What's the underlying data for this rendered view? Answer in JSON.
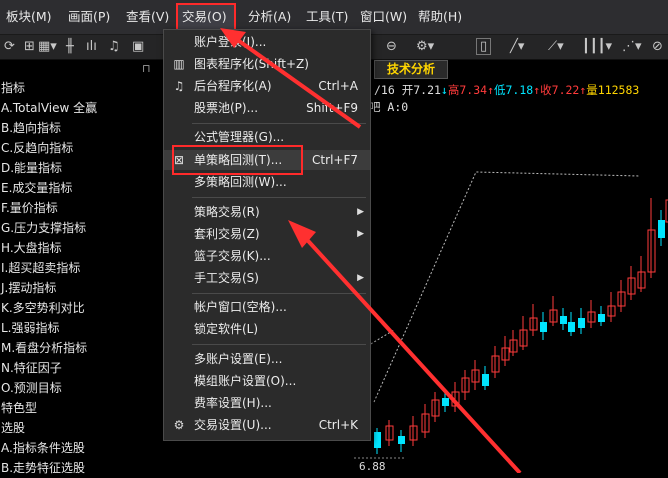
{
  "menubar": {
    "items": [
      {
        "label": "板块(M)"
      },
      {
        "label": "画面(P)"
      },
      {
        "label": "查看(V)"
      },
      {
        "label": "交易(O)"
      },
      {
        "label": "分析(A)"
      },
      {
        "label": "工具(T)"
      },
      {
        "label": "窗口(W)"
      },
      {
        "label": "帮助(H)"
      }
    ]
  },
  "left_panel": {
    "pin": "⊓",
    "items": [
      {
        "label": "指标"
      },
      {
        "label": "A.TotalView 全赢"
      },
      {
        "label": "B.趋向指标"
      },
      {
        "label": "C.反趋向指标"
      },
      {
        "label": "D.能量指标"
      },
      {
        "label": "E.成交量指标"
      },
      {
        "label": "F.量价指标"
      },
      {
        "label": "G.压力支撑指标"
      },
      {
        "label": "H.大盘指标"
      },
      {
        "label": "I.超买超卖指标"
      },
      {
        "label": "J.摆动指标"
      },
      {
        "label": "K.多空势利对比"
      },
      {
        "label": "L.强弱指标"
      },
      {
        "label": "M.看盘分析指标"
      },
      {
        "label": "N.特征因子"
      },
      {
        "label": "O.预测目标"
      },
      {
        "label": "特色型"
      },
      {
        "label": "选股"
      },
      {
        "label": "A.指标条件选股"
      },
      {
        "label": "B.走势特征选股"
      }
    ]
  },
  "chart": {
    "tab_label": "技术分析",
    "info": {
      "date": "/16",
      "open": "开7.21",
      "open_arrow": "↓",
      "high": "高7.34",
      "high_arrow": "↑",
      "low": "低7.18",
      "low_arrow": "↑",
      "close": "收7.22",
      "close_arrow": "↑",
      "volume": "量112583"
    },
    "info2": "吧 A:0",
    "low_price_label": "6.88",
    "colors": {
      "up": "#ff3b3b",
      "down": "#00e5ff",
      "tab_text": "#ffd500"
    }
  },
  "dropdown": {
    "items": [
      {
        "label": "账户登录(I)...",
        "shortcut": "",
        "icon": "",
        "submenu": false
      },
      {
        "label": "图表程序化(Shift+Z)",
        "shortcut": "",
        "icon": "chart-program-icon",
        "submenu": false
      },
      {
        "label": "后台程序化(A)",
        "shortcut": "Ctrl+A",
        "icon": "bell-icon",
        "submenu": false
      },
      {
        "label": "股票池(P)...",
        "shortcut": "Shift+F9",
        "icon": "",
        "submenu": false
      },
      {
        "label": "公式管理器(G)...",
        "shortcut": "",
        "icon": "",
        "submenu": false
      },
      {
        "label": "单策略回测(T)...",
        "shortcut": "Ctrl+F7",
        "icon": "backtest-icon",
        "submenu": false
      },
      {
        "label": "多策略回测(W)...",
        "shortcut": "",
        "icon": "",
        "submenu": false
      },
      {
        "label": "策略交易(R)",
        "shortcut": "",
        "icon": "",
        "submenu": true
      },
      {
        "label": "套利交易(Z)",
        "shortcut": "",
        "icon": "",
        "submenu": true
      },
      {
        "label": "篮子交易(K)...",
        "shortcut": "",
        "icon": "",
        "submenu": false
      },
      {
        "label": "手工交易(S)",
        "shortcut": "",
        "icon": "",
        "submenu": true
      },
      {
        "label": "帐户窗口(空格)...",
        "shortcut": "",
        "icon": "",
        "submenu": false
      },
      {
        "label": "锁定软件(L)",
        "shortcut": "",
        "icon": "",
        "submenu": false
      },
      {
        "label": "多账户设置(E)...",
        "shortcut": "",
        "icon": "",
        "submenu": false
      },
      {
        "label": "模组账户设置(O)...",
        "shortcut": "",
        "icon": "",
        "submenu": false
      },
      {
        "label": "费率设置(H)...",
        "shortcut": "",
        "icon": "",
        "submenu": false
      },
      {
        "label": "交易设置(U)...",
        "shortcut": "Ctrl+K",
        "icon": "gear-icon",
        "submenu": false
      }
    ]
  }
}
